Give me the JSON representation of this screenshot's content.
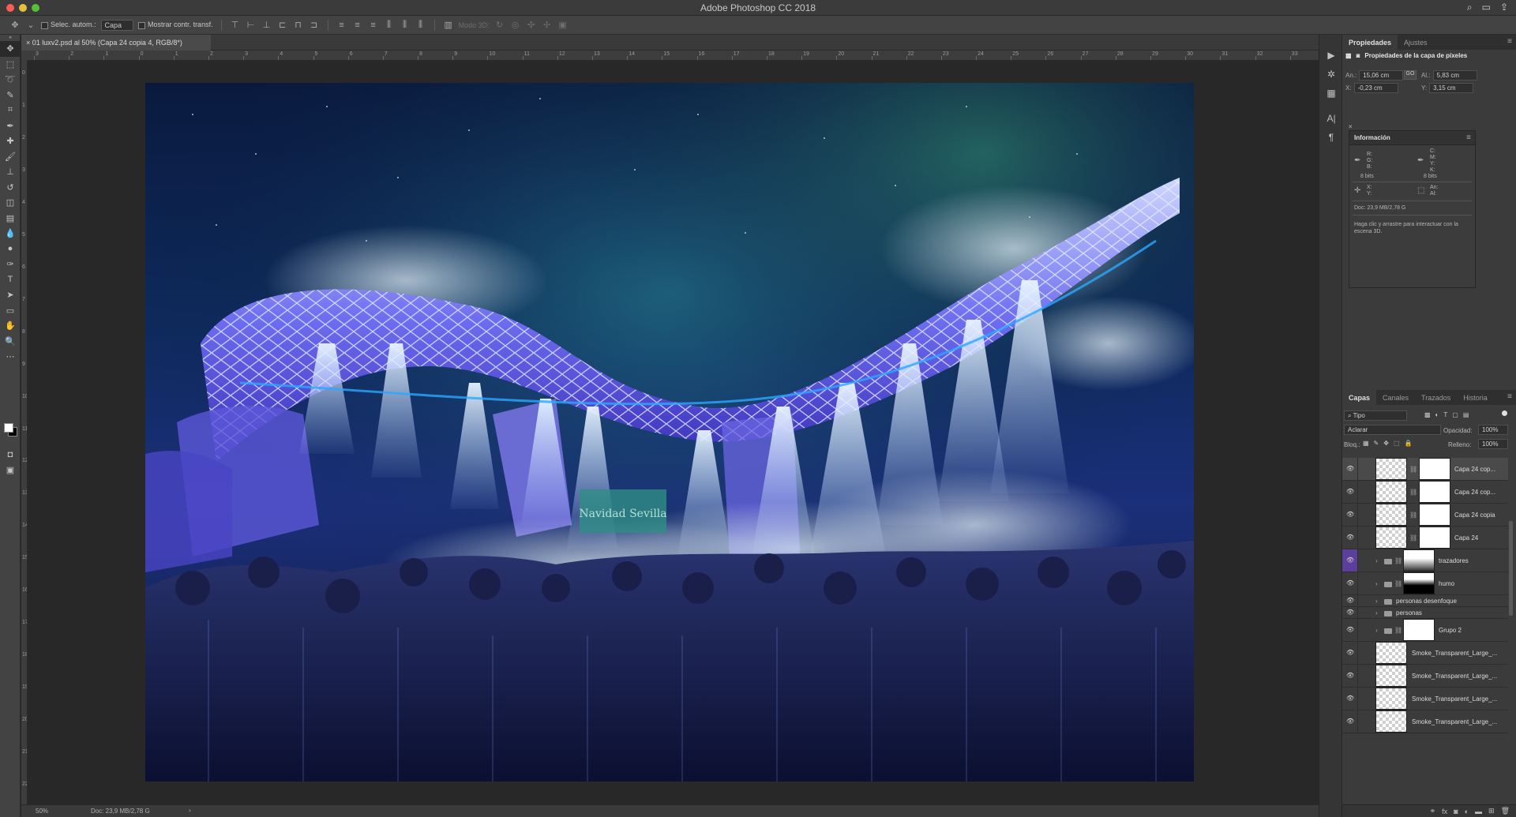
{
  "app": {
    "title": "Adobe Photoshop CC 2018"
  },
  "options_bar": {
    "auto_select_label": "Selec. autom.:",
    "auto_select_value": "Capa",
    "show_transform_label": "Mostrar contr. transf.",
    "mode_3d_label": "Modo 3D:"
  },
  "document": {
    "tab_label": "01 luxv2.psd al 50% (Capa 24 copia 4, RGB/8*)",
    "zoom": "50%",
    "doc_info": "Doc: 23,9 MB/2,78 G",
    "image_text": "Navidad Sevilla"
  },
  "ruler": {
    "h_labels": [
      "3",
      "2",
      "1",
      "0",
      "1",
      "2",
      "3",
      "4",
      "5",
      "6",
      "7",
      "8",
      "9",
      "10",
      "11",
      "12",
      "13",
      "14",
      "15",
      "16",
      "17",
      "18",
      "19",
      "20",
      "21",
      "22",
      "23",
      "24",
      "25",
      "26",
      "27",
      "28",
      "29",
      "30",
      "31",
      "32",
      "33"
    ],
    "v_labels": [
      "0",
      "1",
      "2",
      "3",
      "4",
      "5",
      "6",
      "7",
      "8",
      "9",
      "10",
      "11",
      "12",
      "13",
      "14",
      "15",
      "16",
      "17",
      "18",
      "19",
      "20",
      "21",
      "22"
    ]
  },
  "properties": {
    "tabs": [
      "Propiedades",
      "Ajustes"
    ],
    "title": "Propiedades de la capa de píxeles",
    "width_label": "An.:",
    "width_value": "15,06 cm",
    "height_label": "Al.:",
    "height_value": "5,83 cm",
    "x_label": "X:",
    "x_value": "-0,23 cm",
    "y_label": "Y:",
    "y_value": "3,15 cm",
    "link_label": "GO"
  },
  "info": {
    "title": "Información",
    "rgb_labels": [
      "R:",
      "G:",
      "B:"
    ],
    "cmyk_labels": [
      "C:",
      "M:",
      "Y:",
      "K:"
    ],
    "bits_left": "8 bits",
    "bits_right": "8 bits",
    "xy_labels": [
      "X:",
      "Y:"
    ],
    "size_labels": [
      "An:",
      "Al:"
    ],
    "doc": "Doc: 23,9 MB/2,78 G",
    "hint": "Haga clic y arrastre para interactuar con la escena 3D."
  },
  "layers_panel": {
    "tabs": [
      "Capas",
      "Canales",
      "Trazados",
      "Historia"
    ],
    "filter_value": "Tipo",
    "blend_mode": "Aclarar",
    "opacity_label": "Opacidad:",
    "opacity_value": "100%",
    "lock_label": "Bloq.:",
    "fill_label": "Relleno:",
    "fill_value": "100%",
    "layers": [
      {
        "name": "Capa 24 cop...",
        "type": "masked"
      },
      {
        "name": "Capa 24 cop...",
        "type": "masked"
      },
      {
        "name": "Capa 24 copia",
        "type": "masked"
      },
      {
        "name": "Capa 24",
        "type": "masked"
      },
      {
        "name": "trazadores",
        "type": "group-mask"
      },
      {
        "name": "humo",
        "type": "group-mask"
      },
      {
        "name": "personas desenfoque",
        "type": "group"
      },
      {
        "name": "personas",
        "type": "group"
      },
      {
        "name": "Grupo 2",
        "type": "group-mask"
      },
      {
        "name": "Smoke_Transparent_Large_...",
        "type": "smart"
      },
      {
        "name": "Smoke_Transparent_Large_...",
        "type": "smart"
      },
      {
        "name": "Smoke_Transparent_Large_...",
        "type": "smart"
      },
      {
        "name": "Smoke_Transparent_Large_...",
        "type": "smart"
      }
    ]
  }
}
